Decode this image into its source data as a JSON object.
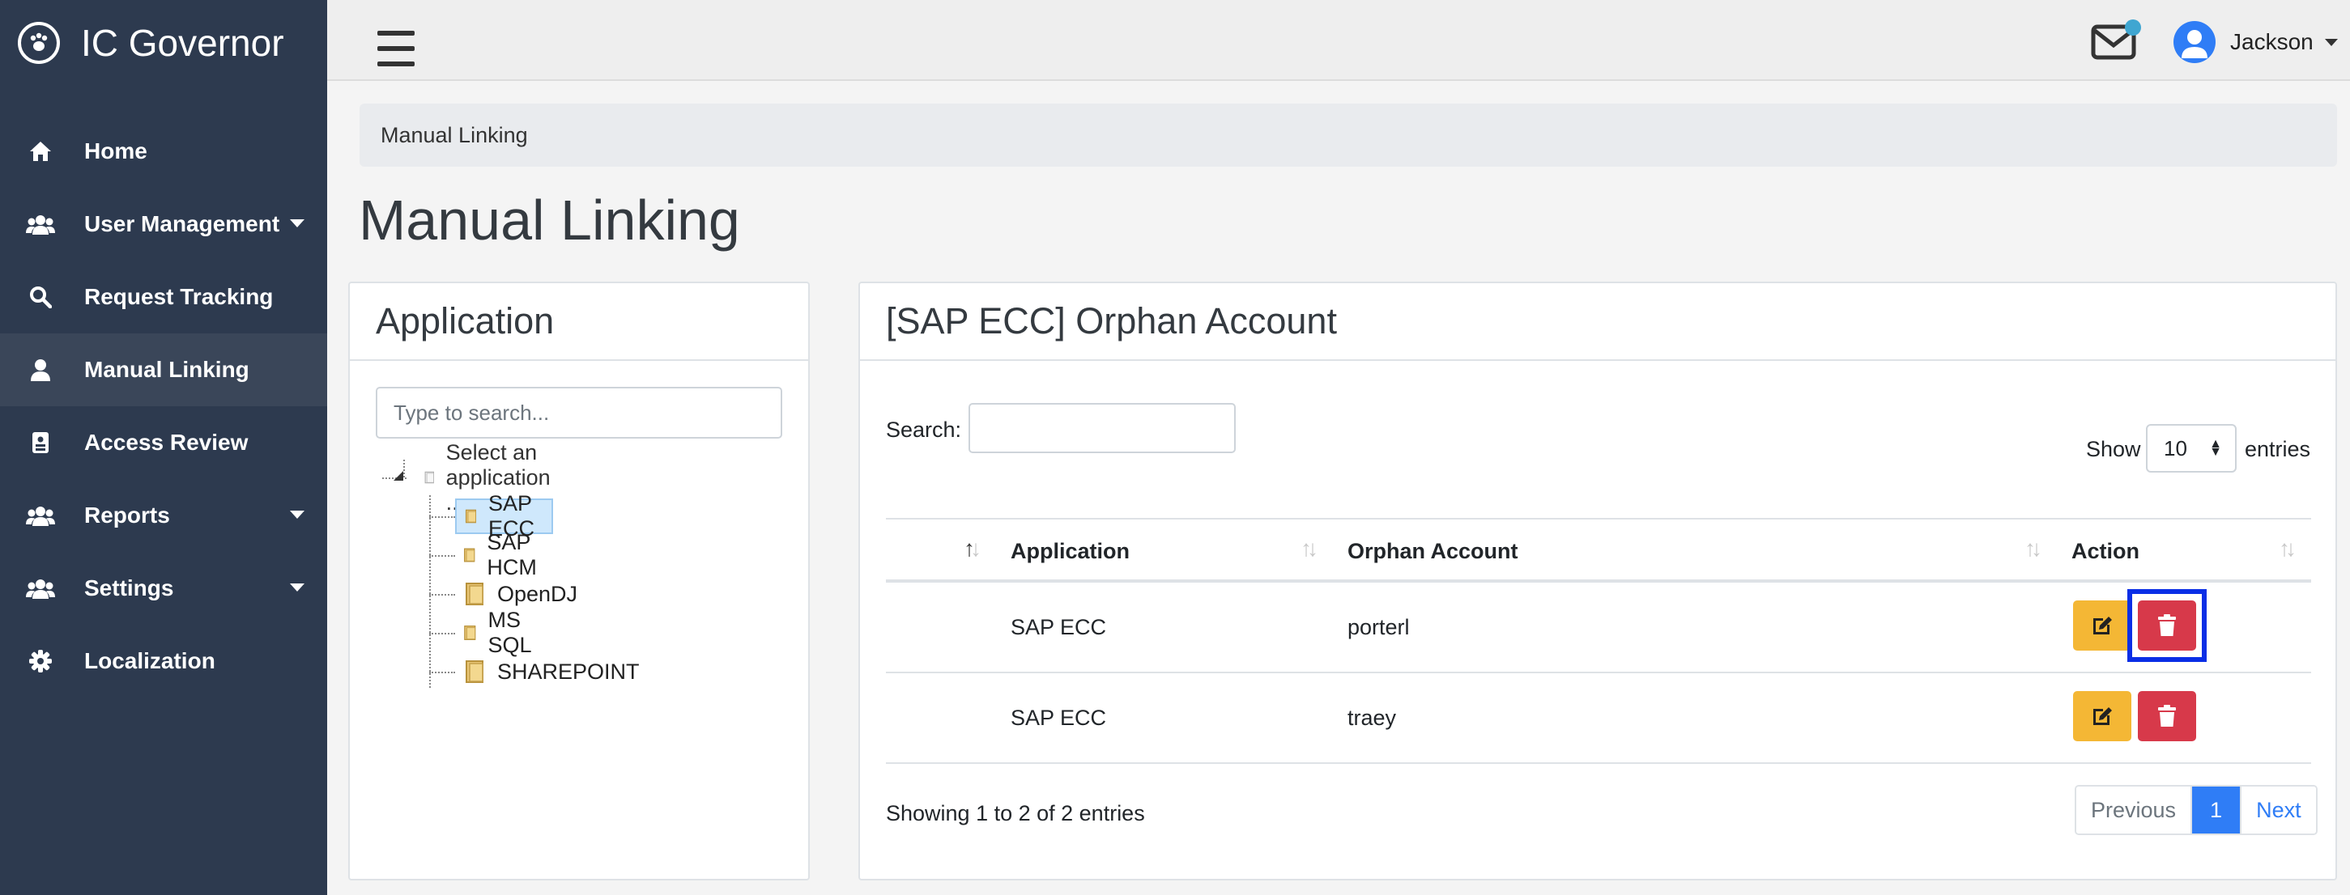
{
  "brand": {
    "title": "IC Governor",
    "icon": "paw-icon"
  },
  "sidebar": {
    "items": [
      {
        "label": "Home",
        "icon": "home-icon",
        "caret": false,
        "active": false
      },
      {
        "label": "User Management",
        "icon": "users-icon",
        "caret": true,
        "active": false
      },
      {
        "label": "Request Tracking",
        "icon": "search-icon",
        "caret": false,
        "active": false
      },
      {
        "label": "Manual Linking",
        "icon": "user-icon",
        "caret": false,
        "active": true
      },
      {
        "label": "Access Review",
        "icon": "clipboard-icon",
        "caret": false,
        "active": false
      },
      {
        "label": "Reports",
        "icon": "users-icon",
        "caret": true,
        "active": false
      },
      {
        "label": "Settings",
        "icon": "users-icon",
        "caret": true,
        "active": false
      },
      {
        "label": "Localization",
        "icon": "gear-icon",
        "caret": false,
        "active": false
      }
    ]
  },
  "topbar": {
    "user_name": "Jackson"
  },
  "breadcrumb": "Manual Linking",
  "page_title": "Manual Linking",
  "application_panel": {
    "title": "Application",
    "search_placeholder": "Type to search...",
    "tree": {
      "root": "Select an application ...",
      "children": [
        "SAP ECC",
        "SAP HCM",
        "OpenDJ",
        "MS SQL",
        "SHAREPOINT"
      ],
      "selected": "SAP ECC"
    }
  },
  "orphan_panel": {
    "title": "[SAP ECC] Orphan Account",
    "search_label": "Search:",
    "show_label": "Show",
    "page_size": "10",
    "entries_label": "entries",
    "columns": [
      "Application",
      "Orphan Account",
      "Action"
    ],
    "rows": [
      {
        "application": "SAP ECC",
        "account": "porterl"
      },
      {
        "application": "SAP ECC",
        "account": "traey"
      }
    ],
    "info": "Showing 1 to 2 of 2 entries",
    "pager": {
      "previous": "Previous",
      "current": "1",
      "next": "Next"
    }
  },
  "colors": {
    "sidebar": "#2d3a4f",
    "edit": "#f4b735",
    "delete": "#d7394a",
    "primary": "#2f7df6",
    "highlight": "#0a2ee6"
  }
}
